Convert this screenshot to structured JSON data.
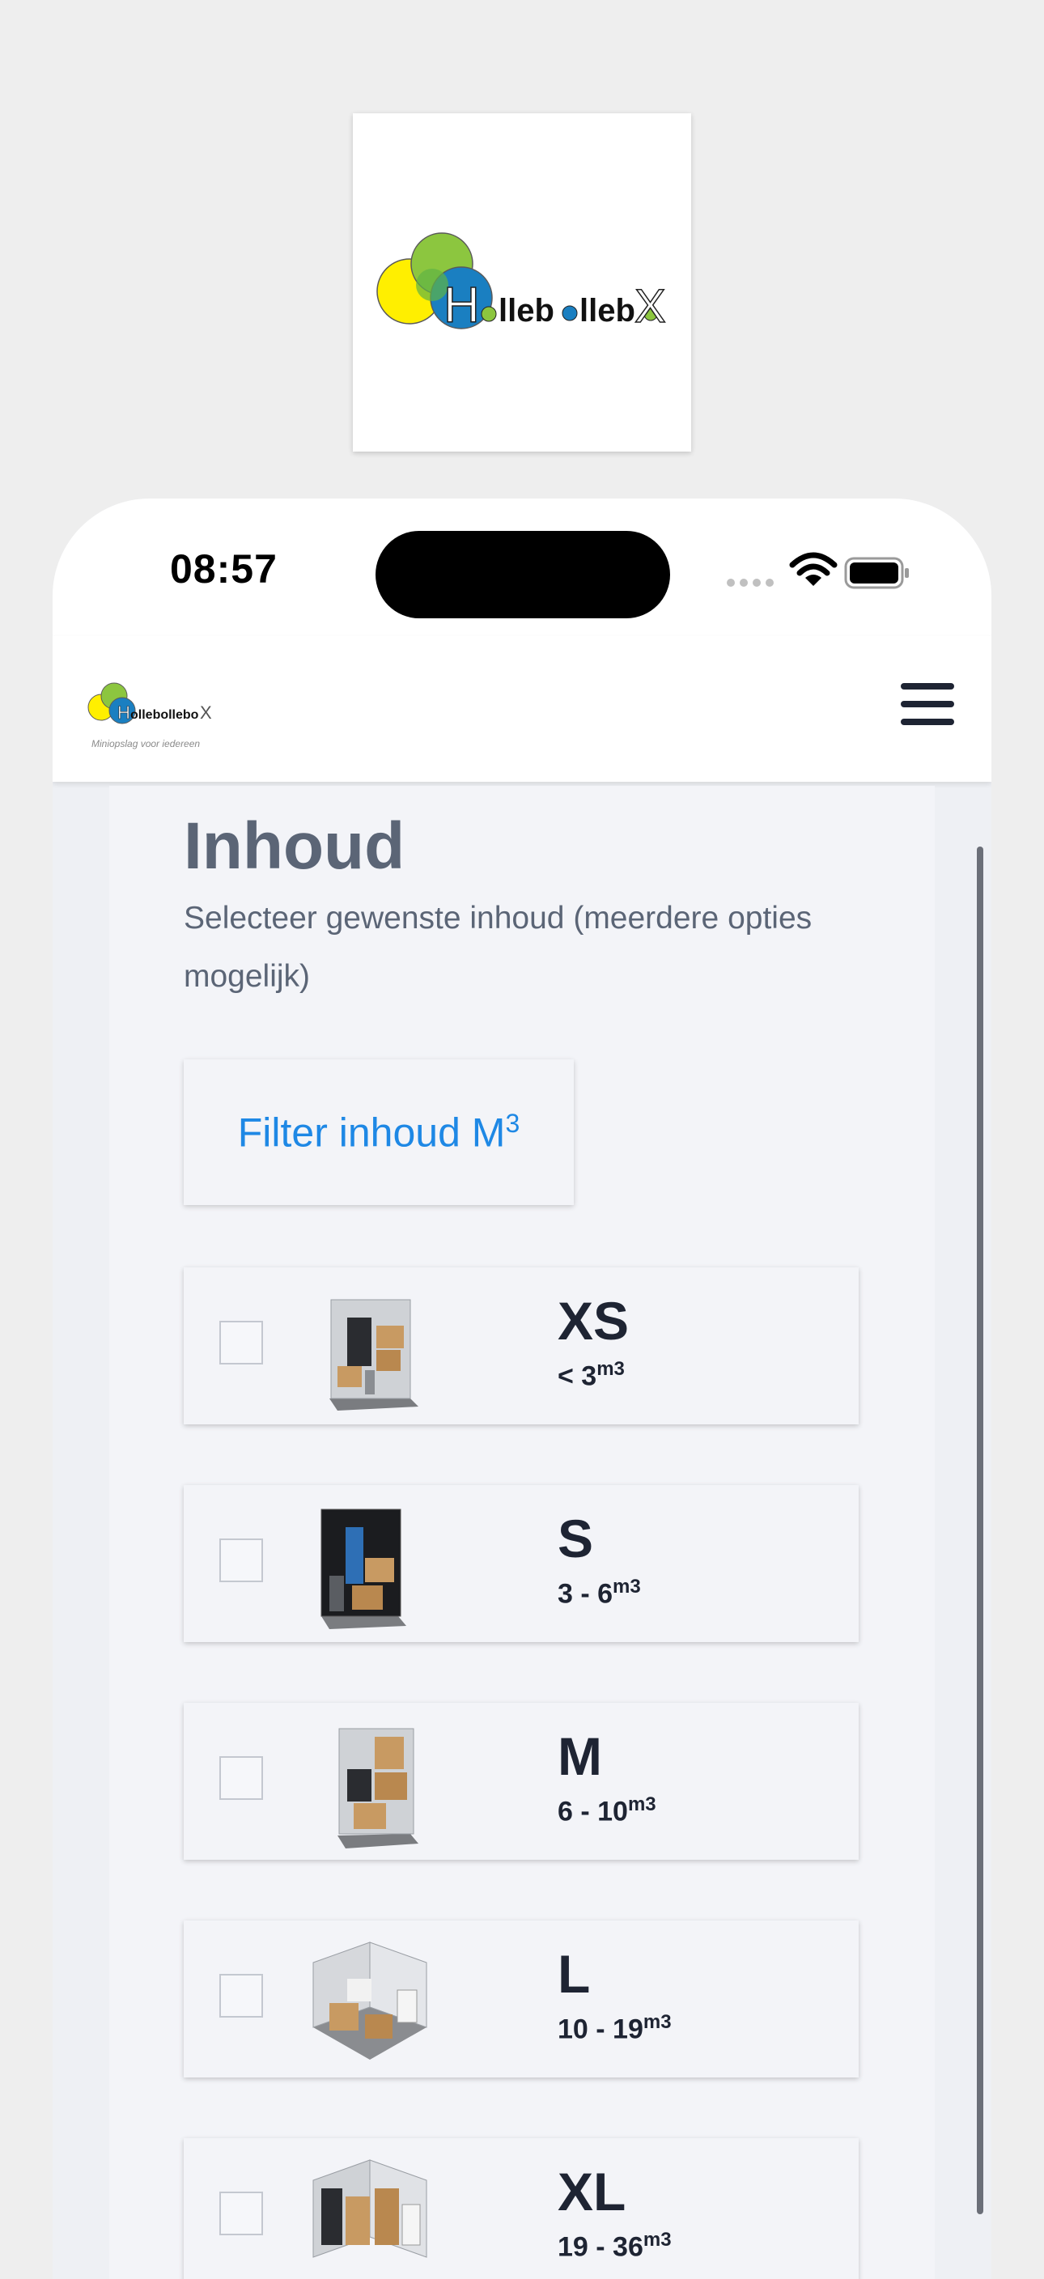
{
  "status_bar": {
    "time": "08:57"
  },
  "brand": {
    "logo_text": "HolleboIleboX",
    "tagline": "Miniopslag voor iedereen"
  },
  "page": {
    "title": "Inhoud",
    "subtitle": "Selecteer gewenste inhoud (meerdere opties mogelijk)",
    "filter_button_label": "Filter inhoud M",
    "filter_button_sup": "3"
  },
  "options": [
    {
      "size": "XS",
      "range": "< 3",
      "unit": "m3",
      "checked": false
    },
    {
      "size": "S",
      "range": "3 - 6",
      "unit": "m3",
      "checked": false
    },
    {
      "size": "M",
      "range": "6 - 10",
      "unit": "m3",
      "checked": false
    },
    {
      "size": "L",
      "range": "10 - 19",
      "unit": "m3",
      "checked": false
    },
    {
      "size": "XL",
      "range": "19 - 36",
      "unit": "m3",
      "checked": false
    }
  ],
  "colors": {
    "accent": "#1e88e5",
    "heading": "#5b6576",
    "text_dark": "#1e2433",
    "logo_yellow": "#ffef00",
    "logo_green": "#8cc63f",
    "logo_blue": "#1a7fc1"
  }
}
